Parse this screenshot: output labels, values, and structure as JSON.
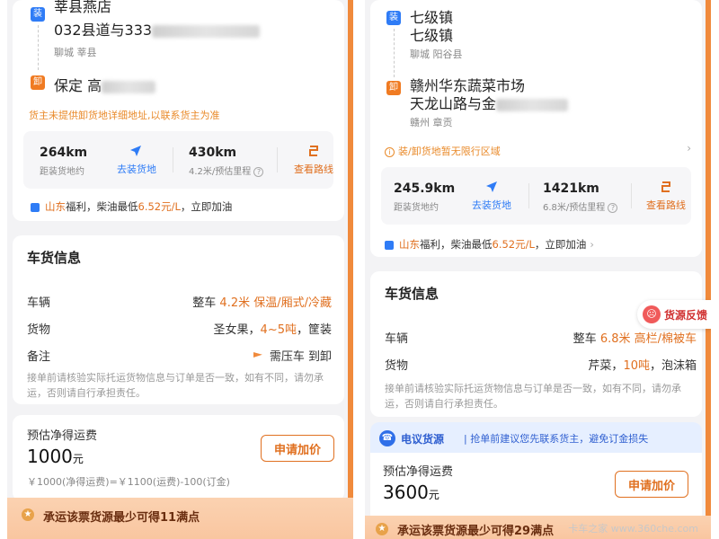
{
  "left": {
    "load_tag": "装",
    "load_line1": "莘县燕店",
    "load_line2_prefix": "032县道与333",
    "load_region": "聊城 莘县",
    "unload_tag": "卸",
    "unload_line_prefix": "保定 高",
    "notice_unload": "货主未提供卸货地详细地址,以联系货主为准",
    "distance_value": "264km",
    "distance_label": "距装货地约",
    "nav_label": "去装货地",
    "total_value": "430km",
    "total_label": "4.2米/预估里程",
    "route_label": "查看路线",
    "promo_region": "山东",
    "promo_mid": "福利，柴油最低",
    "promo_price": "6.52元/L",
    "promo_end": "，立即加油",
    "section_title": "车货信息",
    "vehicle_label": "车辆",
    "vehicle_prefix": "整车 ",
    "vehicle_hl": "4.2米 保温/厢式/冷藏",
    "goods_label": "货物",
    "goods_prefix": "圣女果，",
    "goods_hl": "4~5吨",
    "goods_suffix": "，筐装",
    "remark_label": "备注",
    "remark_value": "需压车 到卸",
    "check_notice": "接单前请核验实际托运货物信息与订单是否一致，如有不同，请勿承运，否则请自行承担责任。",
    "price_label": "预估净得运费",
    "price_value": "1000",
    "price_unit": "元",
    "price_button": "申请加价",
    "formula": "￥1000(净得运费)=￥1100(运费)-100(订金)",
    "bottom_bar": "承运该票货源最少可得11满点"
  },
  "right": {
    "load_tag": "装",
    "load_line1": "七级镇",
    "load_line2": "七级镇",
    "load_region": "聊城 阳谷县",
    "unload_tag": "卸",
    "unload_line1_prefix": "赣州华东蔬菜市场",
    "unload_line2_prefix": "天龙山路与金",
    "unload_region": "赣州 章贡",
    "restrict_notice": "装/卸货地暂无限行区域",
    "distance_value": "245.9km",
    "distance_label": "距装货地约",
    "nav_label": "去装货地",
    "total_value": "1421km",
    "total_label": "6.8米/预估里程",
    "route_label": "查看路线",
    "promo_region": "山东",
    "promo_mid": "福利，柴油最低",
    "promo_price": "6.52元/L",
    "promo_end": "，立即加油",
    "section_title": "车货信息",
    "feedback_label": "货源反馈",
    "vehicle_label": "车辆",
    "vehicle_prefix": "整车 ",
    "vehicle_hl": "6.8米 高栏/棉被车",
    "goods_label": "货物",
    "goods_prefix": "芹菜，",
    "goods_hl": "10吨",
    "goods_suffix": "，泡沫箱",
    "check_notice": "接单前请核验实际托运货物信息与订单是否一致，如有不同，请勿承运，否则请自行承担责任。",
    "banner_title": "电议货源",
    "banner_text": "| 抢单前建议您先联系货主，避免订金损失",
    "price_label": "预估净得运费",
    "price_value": "3600",
    "price_unit": "元",
    "price_button": "申请加价",
    "bottom_bar": "承运该票货源最少可得29满点",
    "watermark": "卡车之家 www.360che.com"
  },
  "colors": {
    "accent_orange": "#e07020",
    "load_blue": "#2f7cf6",
    "unload_orange": "#f07b22",
    "stripe": "#f08a3c"
  }
}
